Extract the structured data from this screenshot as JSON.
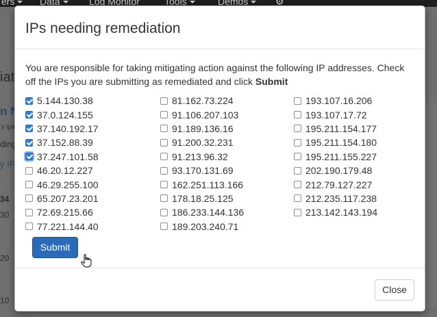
{
  "background": {
    "nav": [
      "ers",
      "Data",
      "Log Monitor",
      "Tools",
      "Demos"
    ],
    "side_texts": [
      "iat",
      "n N",
      "y Ipar",
      "ding",
      "y IP",
      "34",
      "30",
      "20",
      "10"
    ]
  },
  "modal": {
    "title": "IPs needing remediation",
    "intro_prefix": "You are responsible for taking mitigating action against the following IP addresses. Check off the IPs you are submitting as remediated and click ",
    "intro_bold": "Submit",
    "columns": [
      [
        {
          "ip": "5.144.130.38",
          "checked": true
        },
        {
          "ip": "37.0.124.155",
          "checked": true
        },
        {
          "ip": "37.140.192.17",
          "checked": true
        },
        {
          "ip": "37.152.88.39",
          "checked": true
        },
        {
          "ip": "37.247.101.58",
          "checked": true,
          "focused": true
        },
        {
          "ip": "46.20.12.227",
          "checked": false
        },
        {
          "ip": "46.29.255.100",
          "checked": false
        },
        {
          "ip": "65.207.23.201",
          "checked": false
        },
        {
          "ip": "72.69.215.66",
          "checked": false
        },
        {
          "ip": "77.221.144.40",
          "checked": false
        }
      ],
      [
        {
          "ip": "81.162.73.224",
          "checked": false
        },
        {
          "ip": "91.106.207.103",
          "checked": false
        },
        {
          "ip": "91.189.136.16",
          "checked": false
        },
        {
          "ip": "91.200.32.231",
          "checked": false
        },
        {
          "ip": "91.213.96.32",
          "checked": false
        },
        {
          "ip": "93.170.131.69",
          "checked": false
        },
        {
          "ip": "162.251.113.166",
          "checked": false
        },
        {
          "ip": "178.18.25.125",
          "checked": false
        },
        {
          "ip": "186.233.144.136",
          "checked": false
        },
        {
          "ip": "189.203.240.71",
          "checked": false
        }
      ],
      [
        {
          "ip": "193.107.16.206",
          "checked": false
        },
        {
          "ip": "193.107.17.72",
          "checked": false
        },
        {
          "ip": "195.211.154.177",
          "checked": false
        },
        {
          "ip": "195.211.154.180",
          "checked": false
        },
        {
          "ip": "195.211.155.227",
          "checked": false
        },
        {
          "ip": "202.190.179.48",
          "checked": false
        },
        {
          "ip": "212.79.127.227",
          "checked": false
        },
        {
          "ip": "212.235.117.238",
          "checked": false
        },
        {
          "ip": "213.142.143.194",
          "checked": false
        }
      ]
    ],
    "submit_label": "Submit",
    "close_label": "Close"
  },
  "colors": {
    "primary": "#2a6ab8",
    "checkbox_checked": "#2e7fd6"
  }
}
